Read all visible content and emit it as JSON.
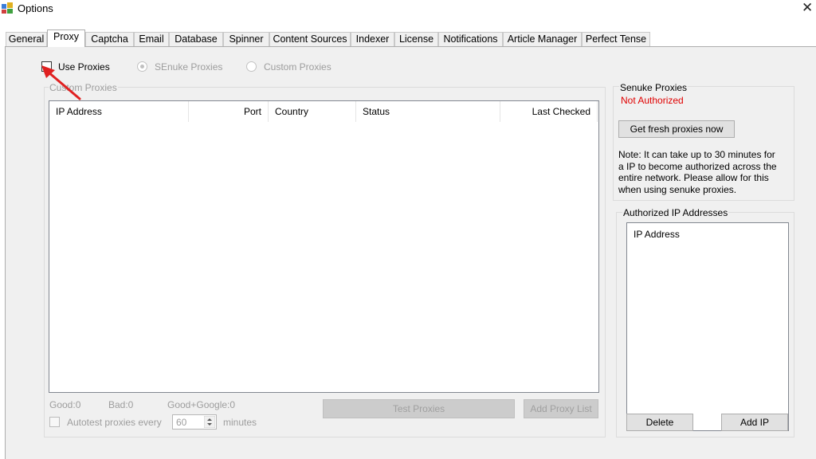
{
  "window": {
    "title": "Options",
    "close_glyph": "✕"
  },
  "tabs": [
    {
      "label": "General"
    },
    {
      "label": "Proxy"
    },
    {
      "label": "Captcha"
    },
    {
      "label": "Email"
    },
    {
      "label": "Database"
    },
    {
      "label": "Spinner"
    },
    {
      "label": "Content Sources"
    },
    {
      "label": "Indexer"
    },
    {
      "label": "License"
    },
    {
      "label": "Notifications"
    },
    {
      "label": "Article Manager"
    },
    {
      "label": "Perfect Tense"
    }
  ],
  "active_tab": "Proxy",
  "proxy": {
    "use_proxies_label": "Use Proxies",
    "use_proxies_checked": false,
    "senuke_radio_label": "SEnuke Proxies",
    "custom_radio_label": "Custom Proxies",
    "custom_group_title": "Custom Proxies",
    "columns": [
      "IP Address",
      "Port",
      "Country",
      "Status",
      "Last Checked"
    ],
    "rows": [],
    "stats": {
      "good": "Good:0",
      "bad": "Bad:0",
      "good_google": "Good+Google:0"
    },
    "autotest_label": "Autotest proxies every",
    "autotest_value": "60",
    "minutes_label": "minutes",
    "test_button": "Test Proxies",
    "add_list_button": "Add Proxy List"
  },
  "senuke": {
    "title": "Senuke Proxies",
    "status": "Not Authorized",
    "status_color": "#e00000",
    "fresh_button": "Get fresh proxies now",
    "note_lines": [
      "Note: It can take up to 30 minutes for",
      "a IP to become authorized across the",
      "entire network. Please allow  for this",
      "when using senuke proxies."
    ]
  },
  "authorized": {
    "title": "Authorized IP Addresses",
    "column": "IP Address",
    "items": [],
    "delete_button": "Delete",
    "add_button": "Add IP"
  },
  "annotation": {
    "arrow_color": "#e02020"
  },
  "icons": {
    "app": "app-window-icon",
    "close": "close-icon",
    "arrow": "red-arrow-annotation",
    "spinner": "up-down-arrows-icon"
  }
}
